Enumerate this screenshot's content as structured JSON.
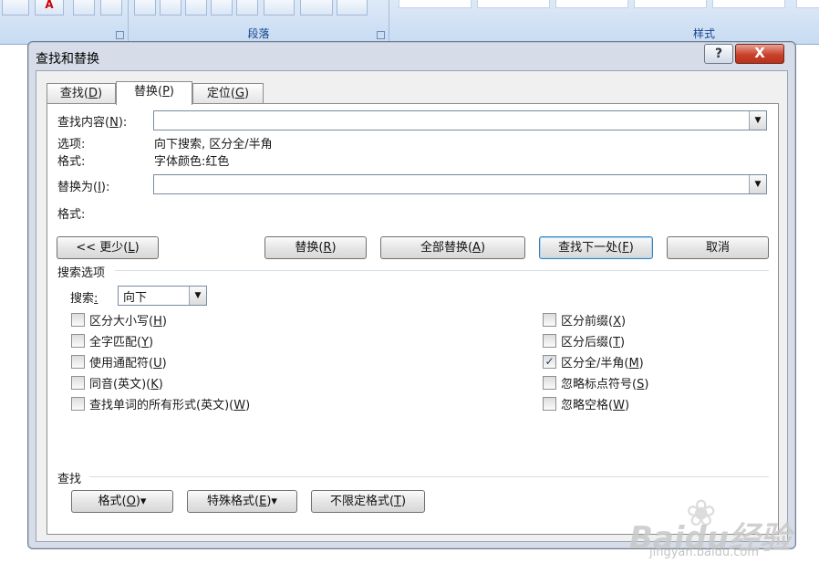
{
  "ribbon": {
    "paragraph_label": "段落",
    "styles_label": "样式"
  },
  "dialog": {
    "title": "查找和替换",
    "help_label": "?",
    "close_label": "X",
    "tabs": [
      {
        "label": "查找(",
        "key": "D",
        "suffix": ")"
      },
      {
        "label": "替换(",
        "key": "P",
        "suffix": ")"
      },
      {
        "label": "定位(",
        "key": "G",
        "suffix": ")"
      }
    ],
    "find": {
      "label_pre": "查找内容(",
      "label_key": "N",
      "label_post": "):",
      "value": "",
      "options_label": "选项:",
      "options_value": "向下搜索, 区分全/半角",
      "format_label": "格式:",
      "format_value": "字体颜色:红色"
    },
    "replace": {
      "label_pre": "替换为(",
      "label_key": "I",
      "label_post": "):",
      "value": "",
      "format_label": "格式:"
    },
    "buttons": {
      "less_pre": "<< 更少(",
      "less_key": "L",
      "less_post": ")",
      "replace_pre": "替换(",
      "replace_key": "R",
      "replace_post": ")",
      "replace_all_pre": "全部替换(",
      "replace_all_key": "A",
      "replace_all_post": ")",
      "find_next_pre": "查找下一处(",
      "find_next_key": "F",
      "find_next_post": ")",
      "cancel": "取消"
    },
    "search_options": {
      "heading": "搜索选项",
      "search_label_pre": "搜索",
      "search_label_key": ":",
      "search_value": "向下",
      "left_checks": [
        {
          "pre": "区分大小写(",
          "key": "H",
          "post": ")",
          "checked": false
        },
        {
          "pre": "全字匹配(",
          "key": "Y",
          "post": ")",
          "checked": false
        },
        {
          "pre": "使用通配符(",
          "key": "U",
          "post": ")",
          "checked": false
        },
        {
          "pre": "同音(英文)(",
          "key": "K",
          "post": ")",
          "checked": false
        },
        {
          "pre": "查找单词的所有形式(英文)(",
          "key": "W",
          "post": ")",
          "checked": false
        }
      ],
      "right_checks": [
        {
          "pre": "区分前缀(",
          "key": "X",
          "post": ")",
          "checked": false
        },
        {
          "pre": "区分后缀(",
          "key": "T",
          "post": ")",
          "checked": false
        },
        {
          "pre": "区分全/半角(",
          "key": "M",
          "post": ")",
          "checked": true
        },
        {
          "pre": "忽略标点符号(",
          "key": "S",
          "post": ")",
          "checked": false
        },
        {
          "pre": "忽略空格(",
          "key": "W",
          "post": ")",
          "checked": false
        }
      ]
    },
    "find_section": {
      "heading": "查找",
      "format_pre": "格式(",
      "format_key": "O",
      "format_post": ")▾",
      "special_pre": "特殊格式(",
      "special_key": "E",
      "special_post": ")▾",
      "no_format_pre": "不限定格式(",
      "no_format_key": "T",
      "no_format_post": ")"
    }
  },
  "watermark": {
    "logo": "Baidu经验",
    "url": "jingyan.baidu.com"
  }
}
